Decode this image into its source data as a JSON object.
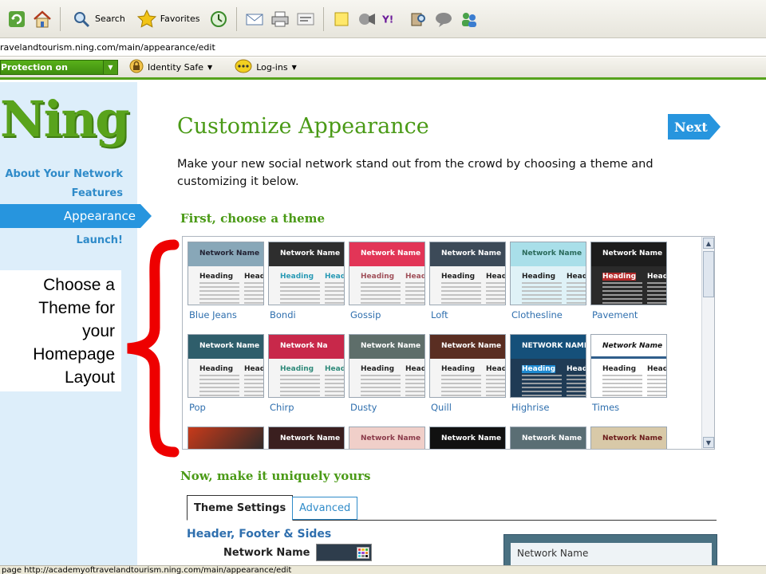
{
  "browser": {
    "toolbar": {
      "search_label": "Search",
      "favorites_label": "Favorites"
    },
    "address": "ravelandtourism.ning.com/main/appearance/edit",
    "security_bar": {
      "protection_label": "Protection on",
      "identity_safe_label": "Identity Safe",
      "logins_label": "Log-ins"
    },
    "status_text": "page http://academyoftravelandtourism.ning.com/main/appearance/edit"
  },
  "sidebar": {
    "logo": "Ning",
    "nav": {
      "about": "About Your Network",
      "features": "Features",
      "appearance": "Appearance",
      "launch": "Launch!"
    }
  },
  "callout": {
    "line1": "Choose a",
    "line2": "Theme for",
    "line3": "your",
    "line4": "Homepage",
    "line5": "Layout",
    "brace_color": "#ee0000"
  },
  "main": {
    "title": "Customize Appearance",
    "next_label": "Next",
    "intro": "Make your new social network stand out from the crowd by choosing a theme and customizing it below.",
    "choose_theme_heading": "First, choose a theme",
    "make_yours_heading": "Now, make it uniquely yours",
    "thumb_network_name": "Network Name",
    "thumb_heading": "Heading",
    "thumb_heading2": "Headi",
    "thumb_highrise_name": "NETWORK NAME",
    "thumb_chirp_name": "Network Na",
    "themes": {
      "blue_jeans": "Blue Jeans",
      "bondi": "Bondi",
      "gossip": "Gossip",
      "loft": "Loft",
      "clothesline": "Clothesline",
      "pavement": "Pavement",
      "pop": "Pop",
      "chirp": "Chirp",
      "dusty": "Dusty",
      "quill": "Quill",
      "highrise": "Highrise",
      "times": "Times"
    },
    "tabs": {
      "theme_settings": "Theme Settings",
      "advanced": "Advanced"
    },
    "section_header": "Header, Footer & Sides",
    "field_network_name": "Network Name",
    "preview_network_name": "Network Name"
  },
  "colors": {
    "ning_green": "#59a31c",
    "ning_blue": "#2795de",
    "link_blue": "#2f6fae"
  }
}
